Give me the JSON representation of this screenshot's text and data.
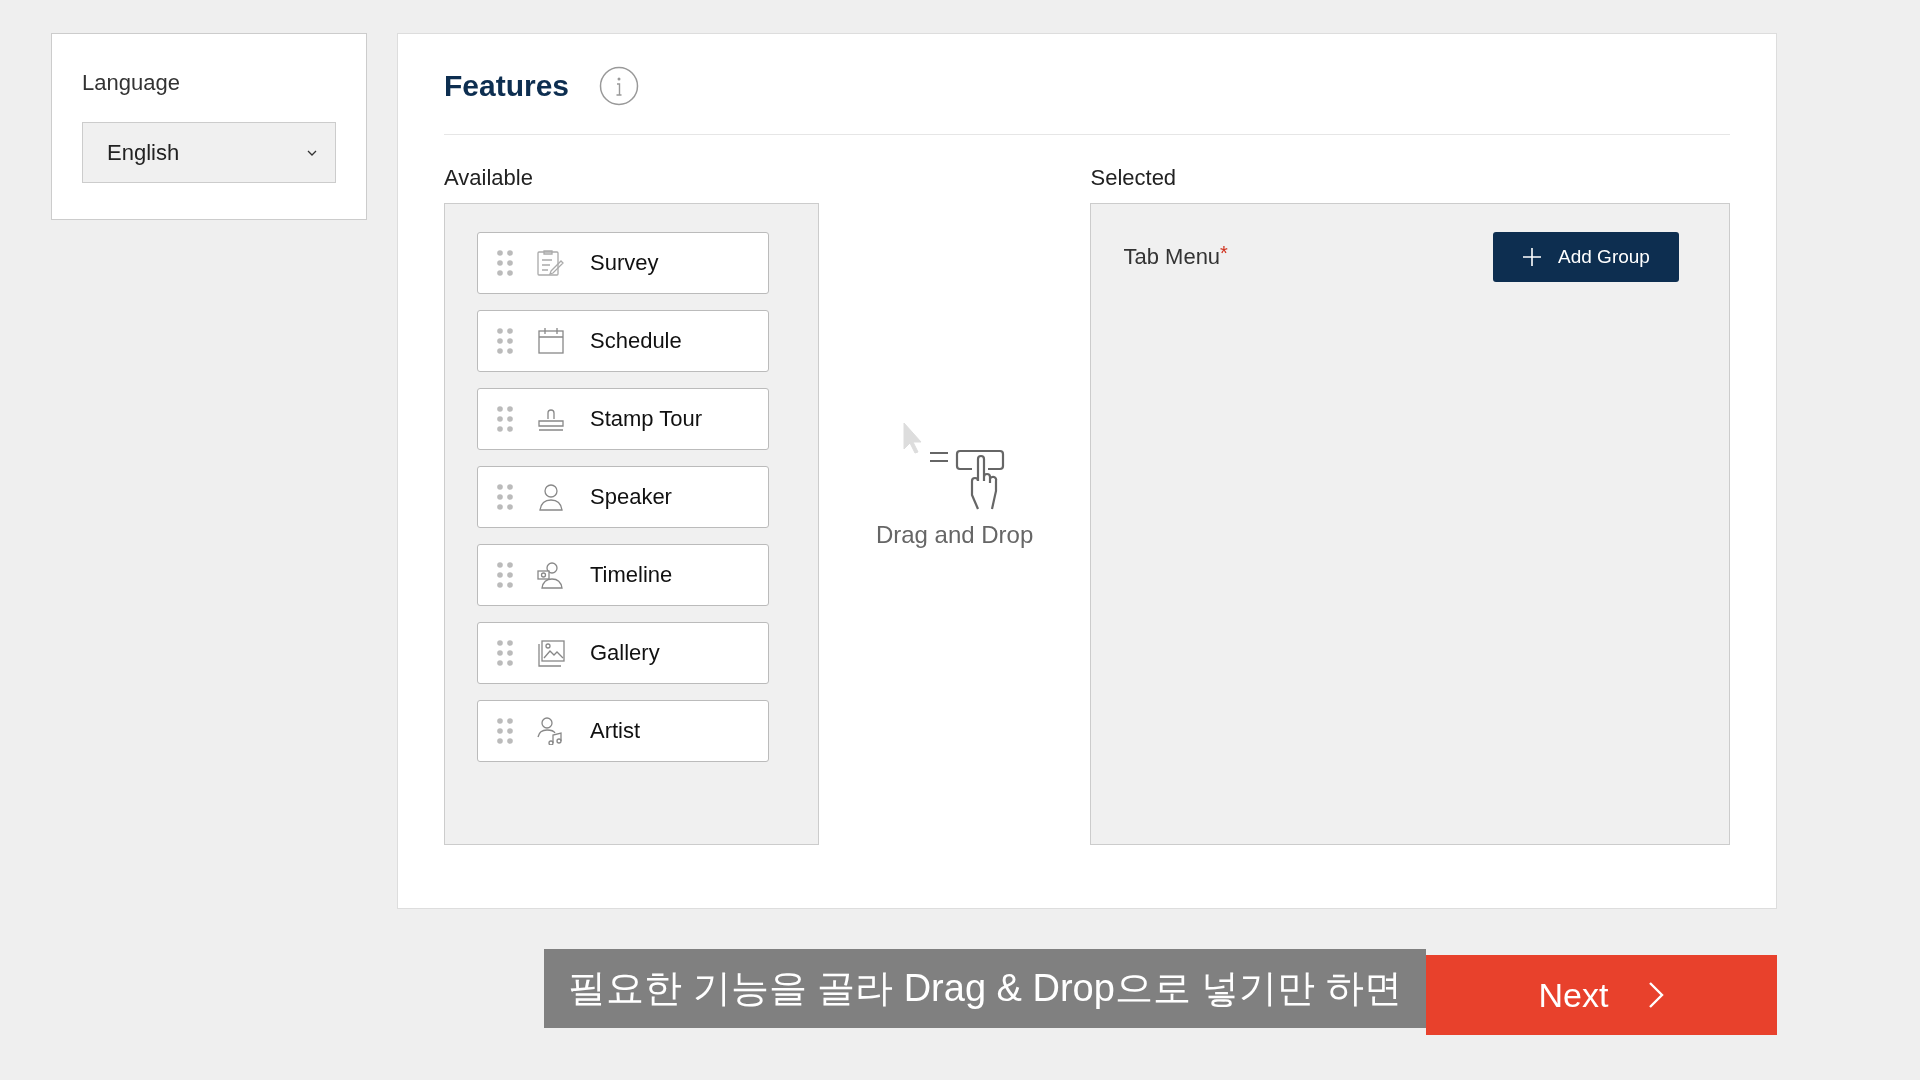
{
  "language": {
    "label": "Language",
    "value": "English"
  },
  "features": {
    "title": "Features",
    "available": {
      "label": "Available",
      "items": [
        {
          "label": "Survey"
        },
        {
          "label": "Schedule"
        },
        {
          "label": "Stamp Tour"
        },
        {
          "label": "Speaker"
        },
        {
          "label": "Timeline"
        },
        {
          "label": "Gallery"
        },
        {
          "label": "Artist"
        }
      ]
    },
    "hint": "Drag and Drop",
    "selected": {
      "label": "Selected",
      "group_label": "Tab Menu",
      "required_mark": "*",
      "add_button": "Add Group"
    }
  },
  "caption": "필요한 기능을 골라 Drag & Drop으로 넣기만 하면",
  "next_button": "Next"
}
